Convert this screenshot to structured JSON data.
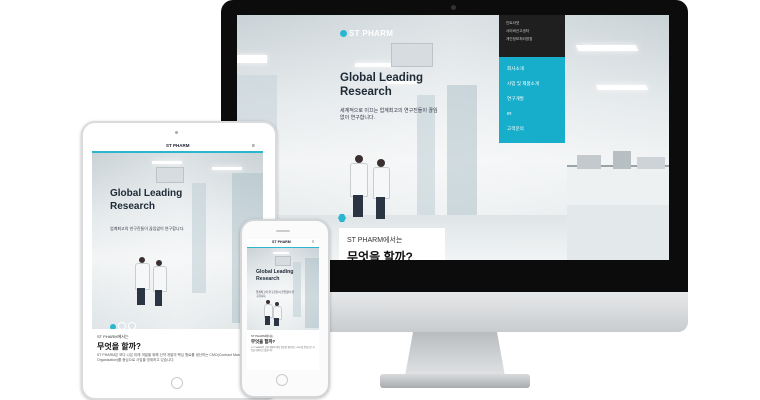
{
  "brand": {
    "logo": "ST PHARM",
    "accent": "#17aecb",
    "dark_nav": "#1f1f1f"
  },
  "desktop": {
    "hero_title": "Global Leading Research",
    "hero_subtitle": "세계적으로 이끄는 업계최고의 연구진들이 끊임없이 연구합니다.",
    "top_links": [
      "인트라넷",
      "사이버신고센터",
      "개인정보처리방침"
    ],
    "nav_items": [
      "회사소개",
      "사업 및 제품소개",
      "연구개발",
      "IR",
      "고객문의"
    ],
    "card_line1": "ST PHARM에서는",
    "card_line2": "무엇을 할까?"
  },
  "tablet": {
    "hero_title": "Global Leading Research",
    "hero_subtitle": "업계최고의 연구진들이 끊임없이 연구합니다.",
    "section_kicker": "ST PHARM에서는",
    "section_title": "무엇을 할까?",
    "section_body": "ST PHARM은 보다 나은 미래 개발을 위해 신약 개발의 핵심 원료를 생산하는 CMO(Contract Manufacturing Organization)를 중심으로 사업을 영위하고 있습니다."
  },
  "phone": {
    "hero_title": "Global Leading Research",
    "hero_subtitle": "업계최고의 연구진들이 끊임없이 연구합니다.",
    "section_kicker": "ST PHARM에서는",
    "section_title": "무엇을 할까?",
    "section_body": "ST PHARM은 신약 개발의 핵심 원료를 생산하는 CMO를 중심으로 사업을 영위하고 있습니다."
  }
}
